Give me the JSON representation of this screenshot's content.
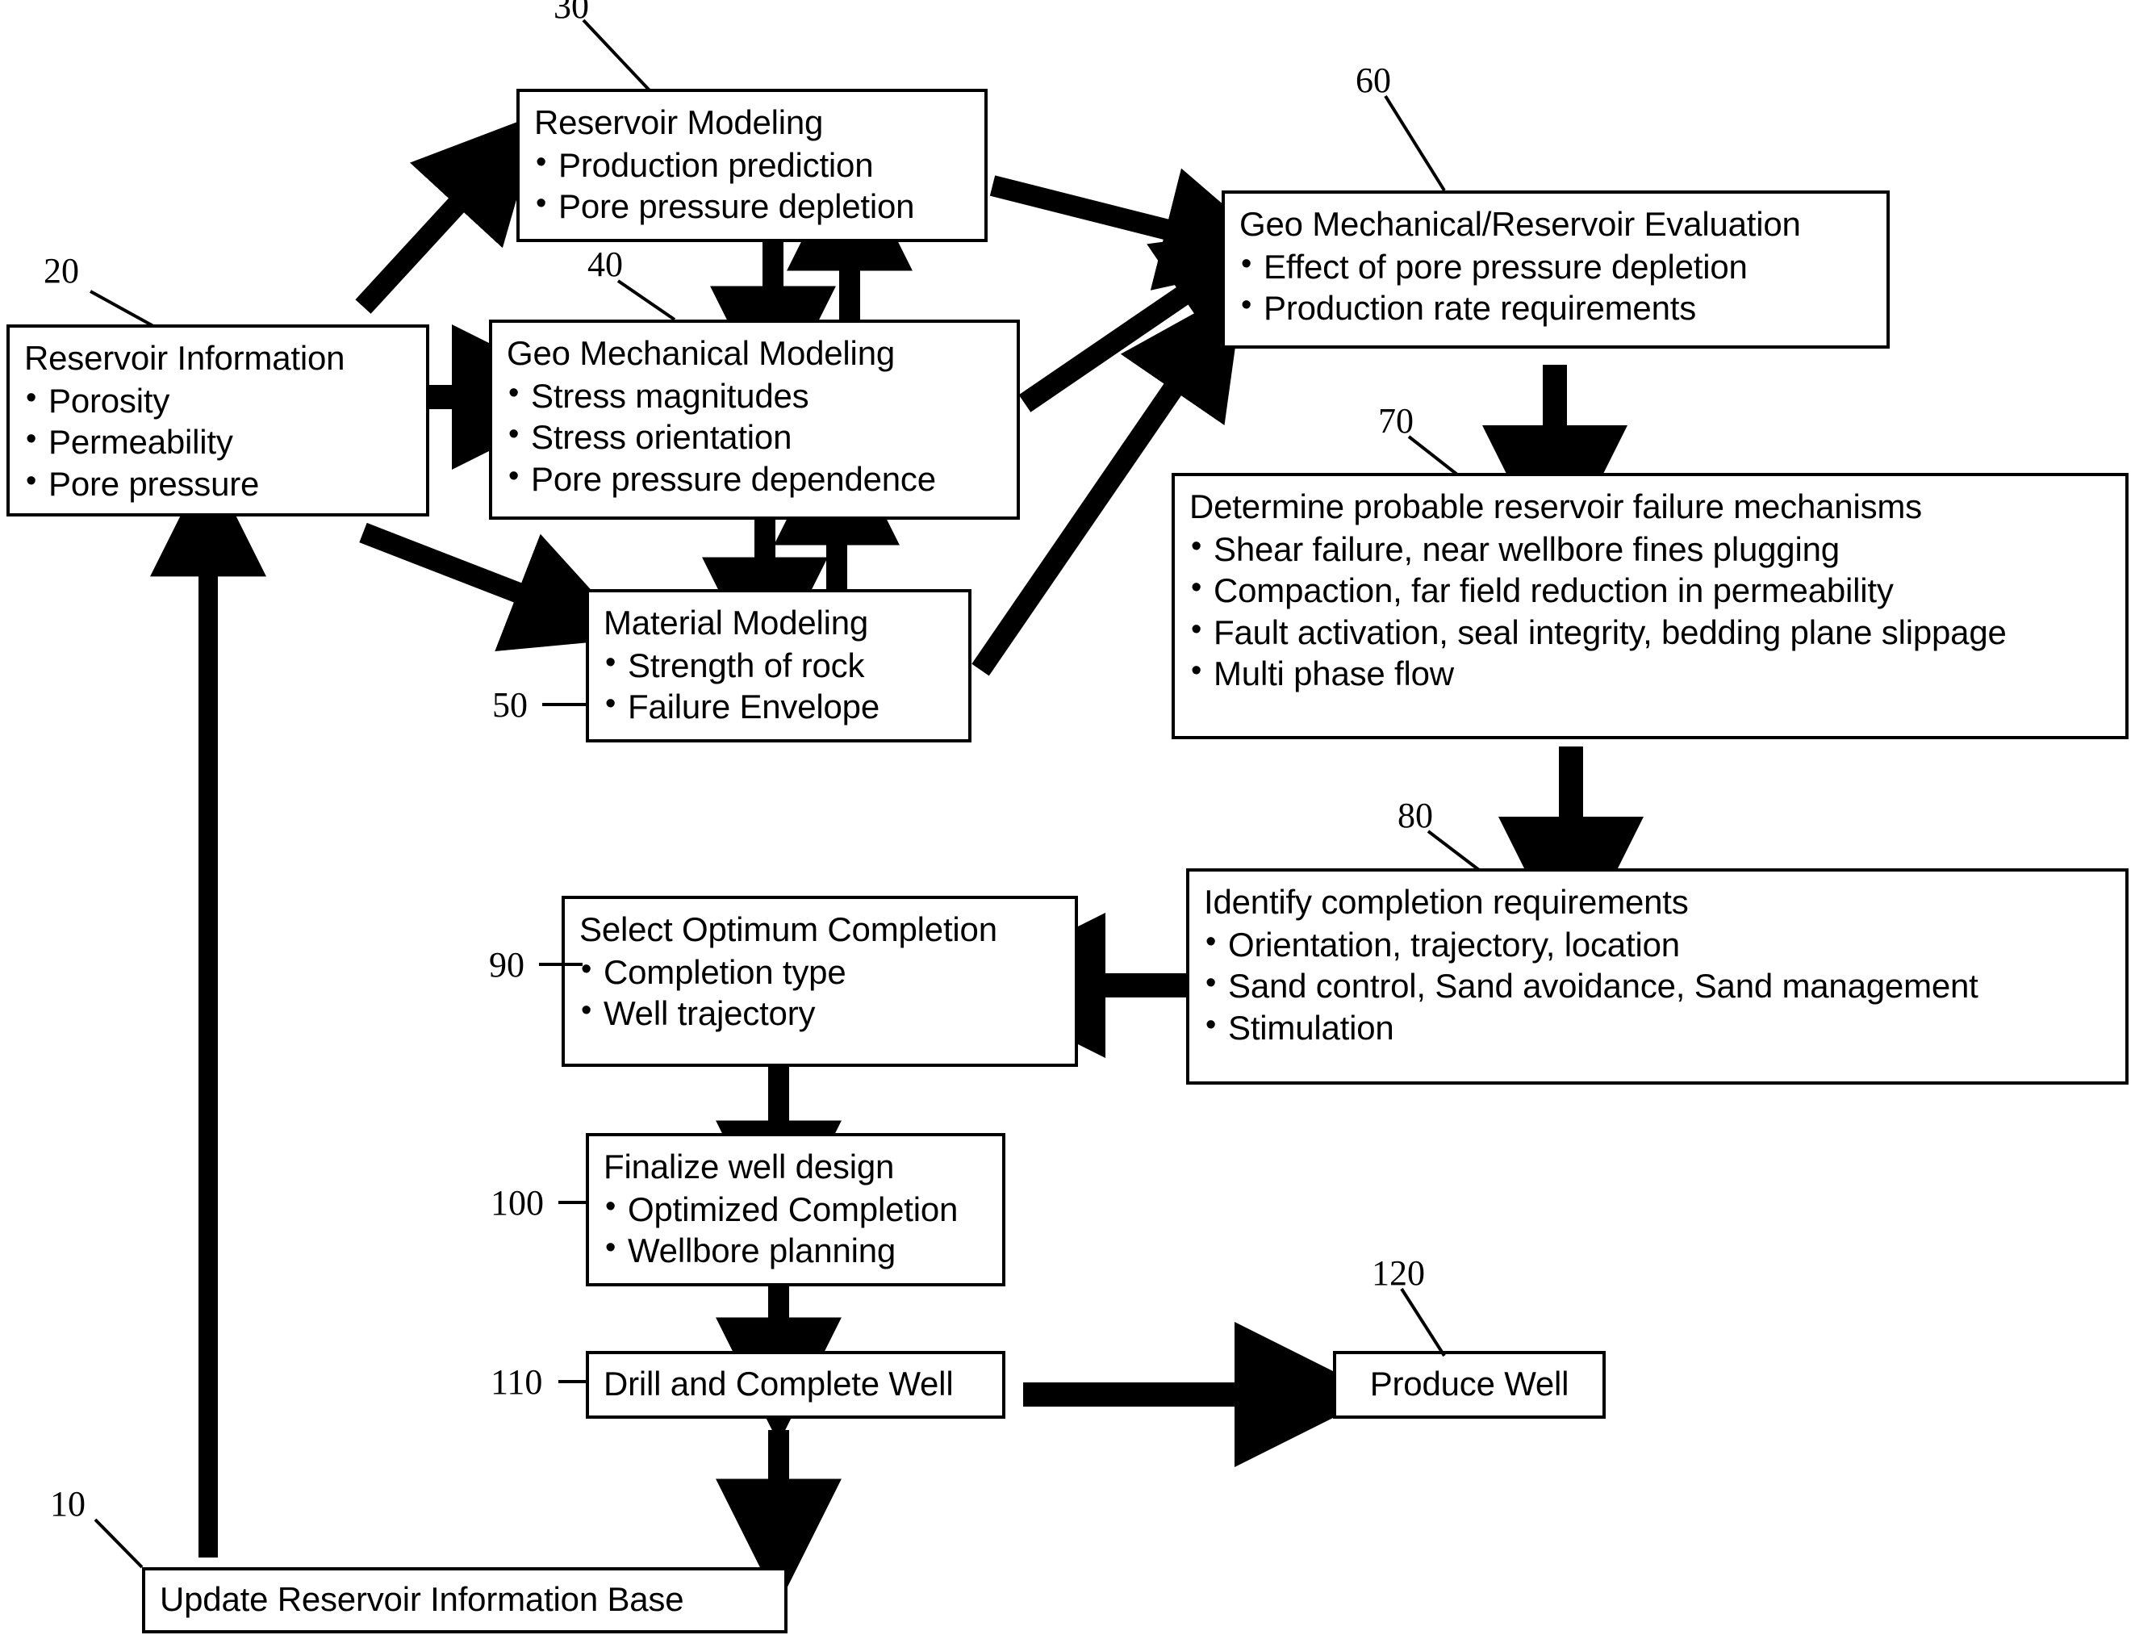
{
  "figure": {
    "type": "patent-flowchart",
    "background": "#ffffff",
    "ink": "#000000"
  },
  "nodes": [
    {
      "id": "n20",
      "ref": "20",
      "title": "Reservoir Information",
      "bullets": [
        "Porosity",
        "Permeability",
        "Pore pressure"
      ]
    },
    {
      "id": "n30",
      "ref": "30",
      "title": "Reservoir Modeling",
      "bullets": [
        "Production prediction",
        "Pore pressure depletion"
      ]
    },
    {
      "id": "n40",
      "ref": "40",
      "title": "Geo Mechanical Modeling",
      "bullets": [
        "Stress magnitudes",
        "Stress orientation",
        "Pore pressure dependence"
      ]
    },
    {
      "id": "n50",
      "ref": "50",
      "title": "Material Modeling",
      "bullets": [
        "Strength of rock",
        "Failure Envelope"
      ]
    },
    {
      "id": "n60",
      "ref": "60",
      "title": "Geo Mechanical/Reservoir Evaluation",
      "bullets": [
        "Effect of pore pressure depletion",
        "Production rate requirements"
      ]
    },
    {
      "id": "n70",
      "ref": "70",
      "title": "Determine probable reservoir failure mechanisms",
      "bullets": [
        "Shear failure, near wellbore fines plugging",
        "Compaction, far field reduction in permeability",
        "Fault activation, seal integrity, bedding plane slippage",
        "Multi phase flow"
      ]
    },
    {
      "id": "n80",
      "ref": "80",
      "title": "Identify completion requirements",
      "bullets": [
        "Orientation, trajectory, location",
        "Sand control, Sand avoidance,  Sand management",
        "Stimulation"
      ]
    },
    {
      "id": "n90",
      "ref": "90",
      "title": "Select Optimum Completion",
      "bullets": [
        "Completion type",
        "Well trajectory"
      ]
    },
    {
      "id": "n100",
      "ref": "100",
      "title": "Finalize well design",
      "bullets": [
        "Optimized Completion",
        "Wellbore planning"
      ]
    },
    {
      "id": "n110",
      "ref": "110",
      "title": "Drill and Complete Well",
      "bullets": []
    },
    {
      "id": "n120",
      "ref": "120",
      "title": "Produce Well",
      "bullets": []
    },
    {
      "id": "n10",
      "ref": "10",
      "title": "Update Reservoir Information Base",
      "bullets": []
    }
  ]
}
